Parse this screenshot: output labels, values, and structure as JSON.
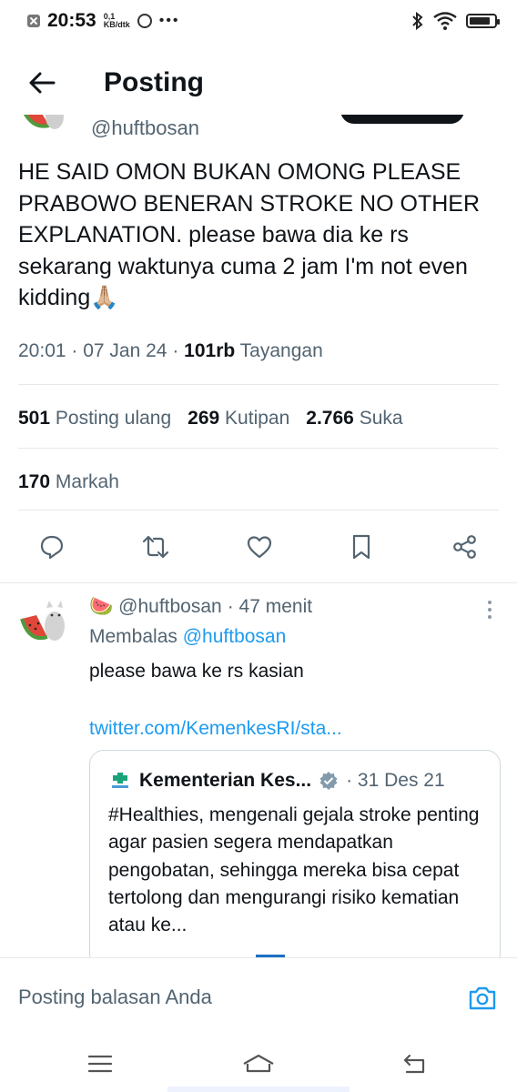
{
  "status_bar": {
    "time": "20:53",
    "speed_value": "0,1",
    "speed_unit": "KB/dtk",
    "more": "•••",
    "battery_level": 0.85
  },
  "header": {
    "title": "Posting"
  },
  "tweet": {
    "handle": "@huftbosan",
    "text": "HE SAID OMON BUKAN OMONG PLEASE PRABOWO BENERAN STROKE NO OTHER EXPLANATION.  please bawa dia ke rs sekarang waktunya cuma 2 jam I'm not even kidding🙏🏼",
    "time": "20:01",
    "date": "07 Jan 24",
    "views_count": "101rb",
    "views_label": "Tayangan",
    "reposts_count": "501",
    "reposts_label": "Posting ulang",
    "quotes_count": "269",
    "quotes_label": "Kutipan",
    "likes_count": "2.766",
    "likes_label": "Suka",
    "bookmarks_count": "170",
    "bookmarks_label": "Markah"
  },
  "reply": {
    "name_emoji": "🍉",
    "handle": "@huftbosan",
    "age": "· 47 menit",
    "replying_prefix": "Membalas",
    "replying_mention": "@huftbosan",
    "text": "please bawa ke rs kasian",
    "link": "twitter.com/KemenkesRI/sta...",
    "quote": {
      "name": "Kementerian Kes...",
      "date": "· 31 Des 21",
      "text": "#Healthies, mengenali gejala stroke penting agar pasien segera mendapatkan pengobatan, sehingga mereka bisa cepat tertolong dan mengurangi risiko kematian atau ke..."
    }
  },
  "composer": {
    "placeholder": "Posting balasan Anda"
  },
  "colors": {
    "text": "#0f1419",
    "secondary": "#536471",
    "link": "#1d9bf0",
    "border": "#cfd9de"
  },
  "icons": {
    "back": "arrow-left-icon",
    "reply": "comment-icon",
    "repost": "repost-icon",
    "like": "heart-icon",
    "bookmark": "bookmark-icon",
    "share": "share-icon",
    "camera": "camera-icon",
    "verified": "verified-badge-icon"
  }
}
